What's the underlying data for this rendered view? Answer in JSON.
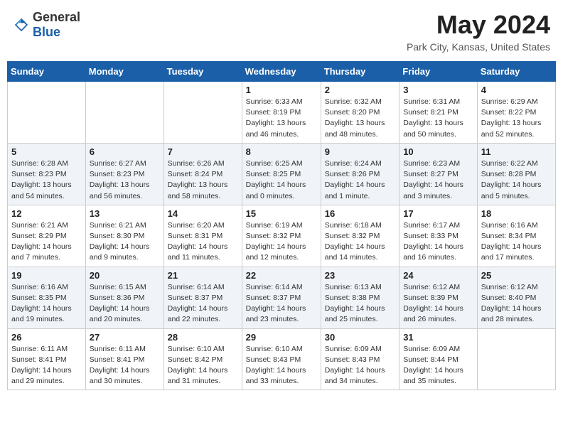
{
  "header": {
    "logo_general": "General",
    "logo_blue": "Blue",
    "month_year": "May 2024",
    "location": "Park City, Kansas, United States"
  },
  "days_of_week": [
    "Sunday",
    "Monday",
    "Tuesday",
    "Wednesday",
    "Thursday",
    "Friday",
    "Saturday"
  ],
  "weeks": [
    [
      {
        "day": "",
        "info": ""
      },
      {
        "day": "",
        "info": ""
      },
      {
        "day": "",
        "info": ""
      },
      {
        "day": "1",
        "info": "Sunrise: 6:33 AM\nSunset: 8:19 PM\nDaylight: 13 hours\nand 46 minutes."
      },
      {
        "day": "2",
        "info": "Sunrise: 6:32 AM\nSunset: 8:20 PM\nDaylight: 13 hours\nand 48 minutes."
      },
      {
        "day": "3",
        "info": "Sunrise: 6:31 AM\nSunset: 8:21 PM\nDaylight: 13 hours\nand 50 minutes."
      },
      {
        "day": "4",
        "info": "Sunrise: 6:29 AM\nSunset: 8:22 PM\nDaylight: 13 hours\nand 52 minutes."
      }
    ],
    [
      {
        "day": "5",
        "info": "Sunrise: 6:28 AM\nSunset: 8:23 PM\nDaylight: 13 hours\nand 54 minutes."
      },
      {
        "day": "6",
        "info": "Sunrise: 6:27 AM\nSunset: 8:23 PM\nDaylight: 13 hours\nand 56 minutes."
      },
      {
        "day": "7",
        "info": "Sunrise: 6:26 AM\nSunset: 8:24 PM\nDaylight: 13 hours\nand 58 minutes."
      },
      {
        "day": "8",
        "info": "Sunrise: 6:25 AM\nSunset: 8:25 PM\nDaylight: 14 hours\nand 0 minutes."
      },
      {
        "day": "9",
        "info": "Sunrise: 6:24 AM\nSunset: 8:26 PM\nDaylight: 14 hours\nand 1 minute."
      },
      {
        "day": "10",
        "info": "Sunrise: 6:23 AM\nSunset: 8:27 PM\nDaylight: 14 hours\nand 3 minutes."
      },
      {
        "day": "11",
        "info": "Sunrise: 6:22 AM\nSunset: 8:28 PM\nDaylight: 14 hours\nand 5 minutes."
      }
    ],
    [
      {
        "day": "12",
        "info": "Sunrise: 6:21 AM\nSunset: 8:29 PM\nDaylight: 14 hours\nand 7 minutes."
      },
      {
        "day": "13",
        "info": "Sunrise: 6:21 AM\nSunset: 8:30 PM\nDaylight: 14 hours\nand 9 minutes."
      },
      {
        "day": "14",
        "info": "Sunrise: 6:20 AM\nSunset: 8:31 PM\nDaylight: 14 hours\nand 11 minutes."
      },
      {
        "day": "15",
        "info": "Sunrise: 6:19 AM\nSunset: 8:32 PM\nDaylight: 14 hours\nand 12 minutes."
      },
      {
        "day": "16",
        "info": "Sunrise: 6:18 AM\nSunset: 8:32 PM\nDaylight: 14 hours\nand 14 minutes."
      },
      {
        "day": "17",
        "info": "Sunrise: 6:17 AM\nSunset: 8:33 PM\nDaylight: 14 hours\nand 16 minutes."
      },
      {
        "day": "18",
        "info": "Sunrise: 6:16 AM\nSunset: 8:34 PM\nDaylight: 14 hours\nand 17 minutes."
      }
    ],
    [
      {
        "day": "19",
        "info": "Sunrise: 6:16 AM\nSunset: 8:35 PM\nDaylight: 14 hours\nand 19 minutes."
      },
      {
        "day": "20",
        "info": "Sunrise: 6:15 AM\nSunset: 8:36 PM\nDaylight: 14 hours\nand 20 minutes."
      },
      {
        "day": "21",
        "info": "Sunrise: 6:14 AM\nSunset: 8:37 PM\nDaylight: 14 hours\nand 22 minutes."
      },
      {
        "day": "22",
        "info": "Sunrise: 6:14 AM\nSunset: 8:37 PM\nDaylight: 14 hours\nand 23 minutes."
      },
      {
        "day": "23",
        "info": "Sunrise: 6:13 AM\nSunset: 8:38 PM\nDaylight: 14 hours\nand 25 minutes."
      },
      {
        "day": "24",
        "info": "Sunrise: 6:12 AM\nSunset: 8:39 PM\nDaylight: 14 hours\nand 26 minutes."
      },
      {
        "day": "25",
        "info": "Sunrise: 6:12 AM\nSunset: 8:40 PM\nDaylight: 14 hours\nand 28 minutes."
      }
    ],
    [
      {
        "day": "26",
        "info": "Sunrise: 6:11 AM\nSunset: 8:41 PM\nDaylight: 14 hours\nand 29 minutes."
      },
      {
        "day": "27",
        "info": "Sunrise: 6:11 AM\nSunset: 8:41 PM\nDaylight: 14 hours\nand 30 minutes."
      },
      {
        "day": "28",
        "info": "Sunrise: 6:10 AM\nSunset: 8:42 PM\nDaylight: 14 hours\nand 31 minutes."
      },
      {
        "day": "29",
        "info": "Sunrise: 6:10 AM\nSunset: 8:43 PM\nDaylight: 14 hours\nand 33 minutes."
      },
      {
        "day": "30",
        "info": "Sunrise: 6:09 AM\nSunset: 8:43 PM\nDaylight: 14 hours\nand 34 minutes."
      },
      {
        "day": "31",
        "info": "Sunrise: 6:09 AM\nSunset: 8:44 PM\nDaylight: 14 hours\nand 35 minutes."
      },
      {
        "day": "",
        "info": ""
      }
    ]
  ]
}
